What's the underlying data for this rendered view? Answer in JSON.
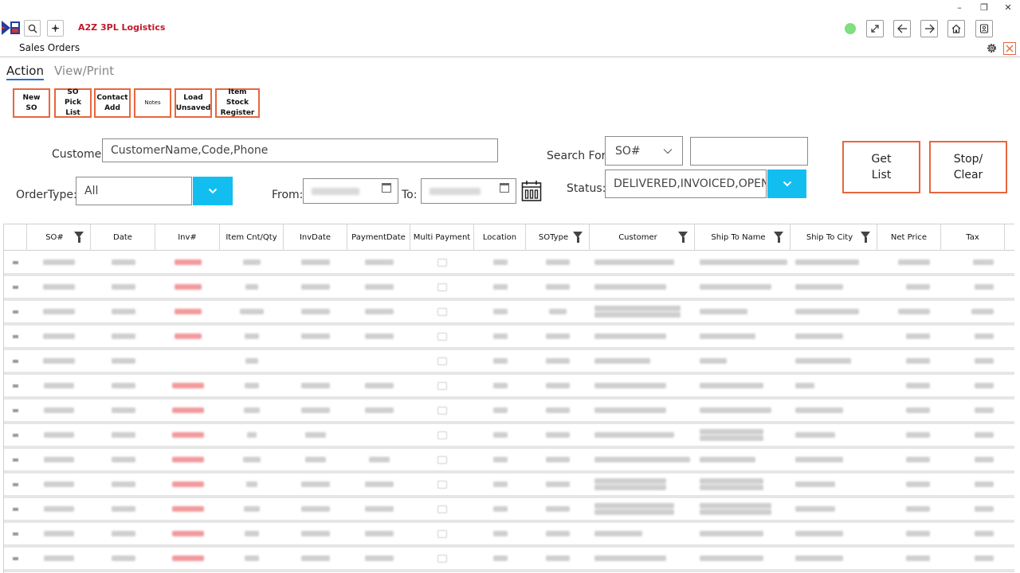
{
  "app": {
    "title": "A2Z 3PL Logistics",
    "page_title": "Sales Orders"
  },
  "colors": {
    "accent_orange": "#e8663d",
    "brand_red": "#c0182a",
    "cyan_button": "#12bef0",
    "status_green": "#7ee07e",
    "tab_underline": "#2a6fd6"
  },
  "window_controls": {
    "minimize": "–",
    "restore": "❐",
    "close": "✕"
  },
  "tabs": [
    {
      "label": "Action",
      "active": true
    },
    {
      "label": "View/Print",
      "active": false
    }
  ],
  "actions": [
    {
      "label": "New\nSO"
    },
    {
      "label": "SO\nPick List"
    },
    {
      "label": "Contact\nAdd"
    },
    {
      "label": "Notes"
    },
    {
      "label": "Load\nUnsaved"
    },
    {
      "label": "Item Stock\nRegister"
    }
  ],
  "filters": {
    "customer_label": "Customer:",
    "customer_placeholder": "CustomerName,Code,Phone",
    "ordertype_label": "OrderType:",
    "ordertype_value": "All",
    "from_label": "From:",
    "to_label": "To:",
    "searchfor_label": "Search For:",
    "searchfor_value": "SO#",
    "status_label": "Status:",
    "status_value": "DELIVERED,INVOICED,OPEN,"
  },
  "buttons": {
    "get_list": "Get\nList",
    "stop_clear": "Stop/\nClear"
  },
  "grid": {
    "columns": [
      "SO#",
      "Date",
      "Inv#",
      "Item Cnt/Qty",
      "InvDate",
      "PaymentDate",
      "Multi Payment",
      "Location",
      "SOType",
      "Customer",
      "Ship To Name",
      "Ship To City",
      "Net Price",
      "Tax"
    ],
    "filter_columns": [
      "SO#",
      "SOType",
      "Customer",
      "Ship To Name",
      "Ship To City"
    ],
    "row_count": 13
  },
  "icons": {
    "search": "search-icon",
    "move": "move-icon",
    "expand": "expand-icon",
    "back": "arrow-left-icon",
    "forward": "arrow-right-icon",
    "home": "home-icon",
    "profile": "user-badge-icon",
    "gear": "gear-icon",
    "close": "close-icon",
    "calendar": "calendar-icon",
    "filter": "filter-icon",
    "chevron": "chevron-down-icon"
  }
}
